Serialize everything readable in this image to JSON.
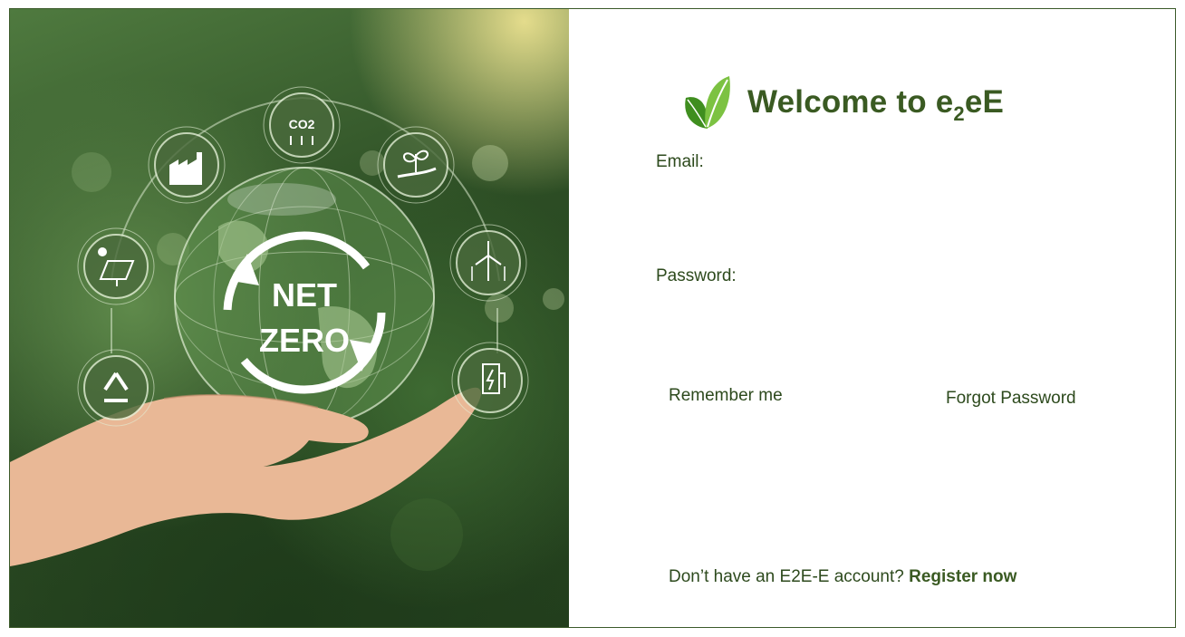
{
  "hero": {
    "badge_text_line1": "NET",
    "badge_text_line2": "ZERO",
    "co2_label": "CO2",
    "icons": [
      "co2-icon",
      "factory-icon",
      "plant-hand-icon",
      "solar-panel-icon",
      "wind-turbine-icon",
      "recycle-icon",
      "ev-charger-icon"
    ]
  },
  "brand": {
    "title_prefix": "Welcome to e",
    "title_subscript": "2",
    "title_suffix": "eE",
    "accent": "#3a5a22",
    "leaf_colors": [
      "#3f8e1f",
      "#7cc242"
    ]
  },
  "form": {
    "email_label": "Email:",
    "email_value": "",
    "password_label": "Password:",
    "password_value": "",
    "remember_label": "Remember me",
    "forgot_label": "Forgot Password"
  },
  "footer": {
    "prompt_text": "Don’t have an E2E-E account?",
    "register_label": "Register now"
  }
}
